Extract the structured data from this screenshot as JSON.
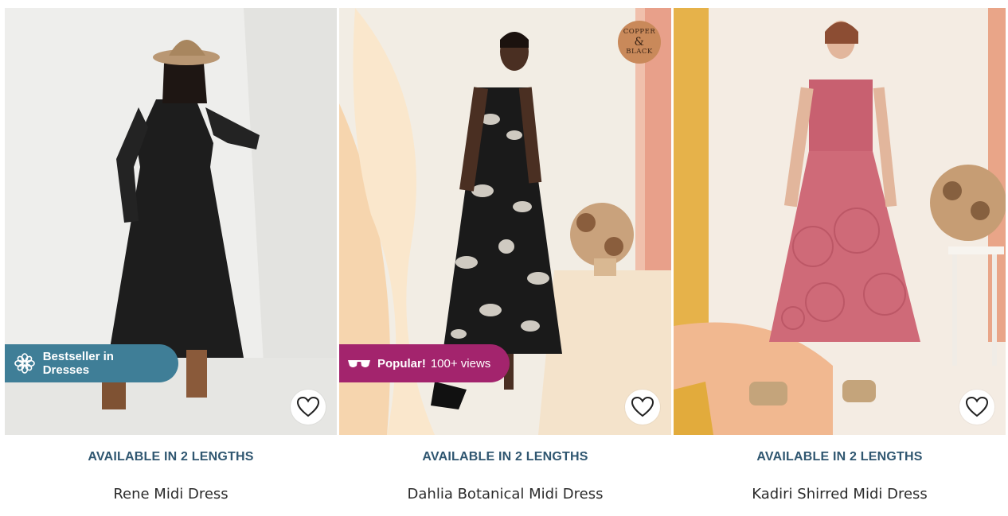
{
  "products": [
    {
      "photo_alt": "Rene Midi Dress",
      "badge_label": "Bestseller in Dresses",
      "badge_icon": "flower-icon",
      "lengths_label": "AVAILABLE IN 2 LENGTHS",
      "name": "Rene Midi Dress",
      "badge_color": "#3f7e97"
    },
    {
      "photo_alt": "Dahlia Botanical Midi Dress",
      "badge_label": "Popular!",
      "badge_extra": "100+ views",
      "badge_icon": "glasses-icon",
      "swatch_top": "COPPER",
      "swatch_amp": "&",
      "swatch_bottom": "BLACK",
      "lengths_label": "AVAILABLE IN 2 LENGTHS",
      "name": "Dahlia Botanical Midi Dress",
      "badge_color": "#a3246d"
    },
    {
      "photo_alt": "Kadiri Shirred Midi Dress",
      "lengths_label": "AVAILABLE IN 2 LENGTHS",
      "name": "Kadiri Shirred Midi Dress"
    }
  ],
  "colors": {
    "lengths_text": "#2f5670",
    "name_text": "#2b2b2b",
    "swatch": "#c9895a"
  }
}
